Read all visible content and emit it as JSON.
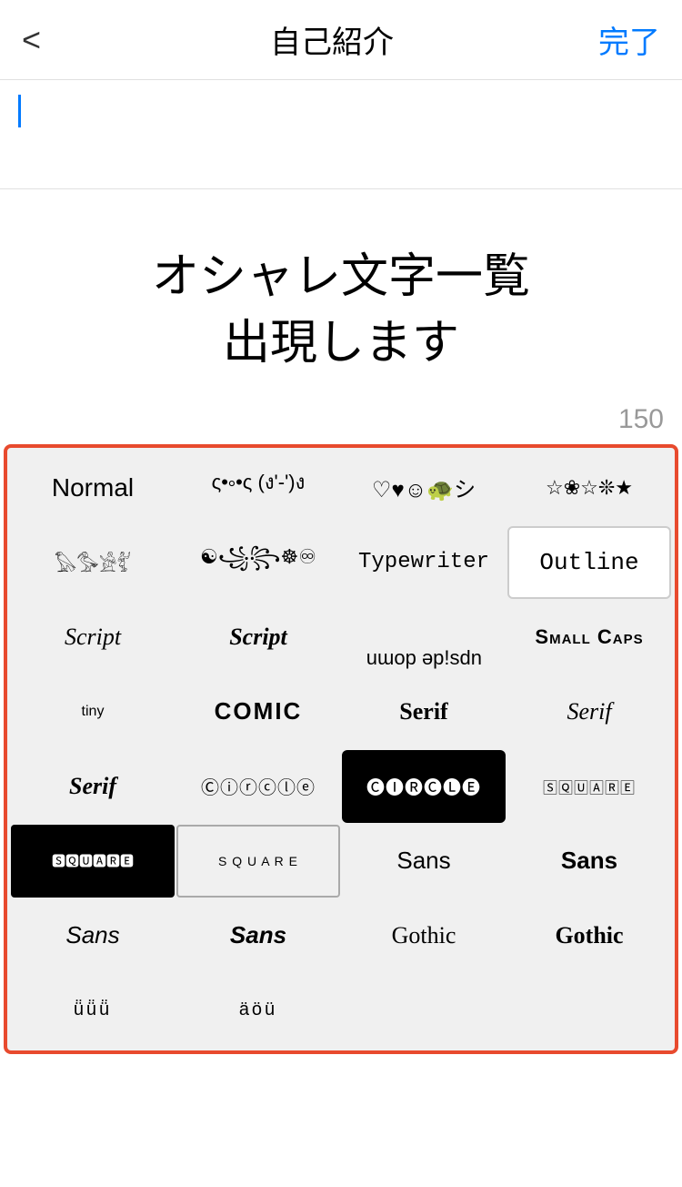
{
  "header": {
    "back_label": "<",
    "title": "自己紹介",
    "done_label": "完了"
  },
  "text_area": {
    "placeholder": ""
  },
  "prompt": {
    "line1": "オシャレ文字一覧",
    "line2": "出現します"
  },
  "char_count": "150",
  "font_grid": {
    "cells": [
      {
        "id": "normal",
        "label": "Normal",
        "style": "normal"
      },
      {
        "id": "symbols1",
        "label": "ς•༚•ς (ง'-')ง",
        "style": "symbols"
      },
      {
        "id": "hearts",
        "label": "♡♥☺🐢シ",
        "style": "hearts"
      },
      {
        "id": "stars",
        "label": "☆❀☆❊★",
        "style": "stars"
      },
      {
        "id": "egypt",
        "label": "𓅃𓅜𓀀𓀤",
        "style": "egypt"
      },
      {
        "id": "swirls",
        "label": "☯꧁꧂☸♾",
        "style": "swirls"
      },
      {
        "id": "typewriter",
        "label": "Typewriter",
        "style": "typewriter"
      },
      {
        "id": "outline",
        "label": "Outline",
        "style": "outline"
      },
      {
        "id": "script",
        "label": "Script",
        "style": "script"
      },
      {
        "id": "script-bold",
        "label": "Script",
        "style": "script-bold"
      },
      {
        "id": "upsidedown",
        "label": "uɯop ǝp!sdn",
        "style": "upsidedown"
      },
      {
        "id": "smallcaps",
        "label": "Small Caps",
        "style": "smallcaps"
      },
      {
        "id": "tiny",
        "label": "tiny",
        "style": "tiny"
      },
      {
        "id": "comic",
        "label": "COMIC",
        "style": "comic"
      },
      {
        "id": "serif-bold",
        "label": "Serif",
        "style": "serif-bold"
      },
      {
        "id": "serif-italic",
        "label": "Serif",
        "style": "serif-italic"
      },
      {
        "id": "serif-bold-italic",
        "label": "Serif",
        "style": "serif-bold-italic"
      },
      {
        "id": "circle-outline",
        "label": "Ⓒⓘⓡⓒⓛⓔ",
        "style": "circle-outline"
      },
      {
        "id": "circle-filled",
        "label": "ⒸⒾⓇⒸⓁⒺ",
        "style": "circle-filled"
      },
      {
        "id": "square-border",
        "label": "🅂🅀🅄🄰🅁🄴",
        "style": "square-border"
      },
      {
        "id": "square-filled",
        "label": "🆂🆀🆄🅰🆁🅴",
        "style": "square-filled"
      },
      {
        "id": "square-outline2",
        "label": "⬜Q⬜A⬜E",
        "style": "square-outline"
      },
      {
        "id": "sans",
        "label": "Sans",
        "style": "sans"
      },
      {
        "id": "sans-bold",
        "label": "Sans",
        "style": "sans-bold"
      },
      {
        "id": "sans-italic",
        "label": "Sans",
        "style": "sans-italic"
      },
      {
        "id": "sans-bold-italic",
        "label": "Sans",
        "style": "sans-bold-italic"
      },
      {
        "id": "gothic",
        "label": "Gothic",
        "style": "gothic"
      },
      {
        "id": "gothic-bold",
        "label": "Gothic",
        "style": "gothic-bold"
      },
      {
        "id": "dotted1",
        "label": "ü̈ü̈ü̈",
        "style": "dotted"
      },
      {
        "id": "dotted2",
        "label": "äöü",
        "style": "dotted"
      }
    ]
  }
}
